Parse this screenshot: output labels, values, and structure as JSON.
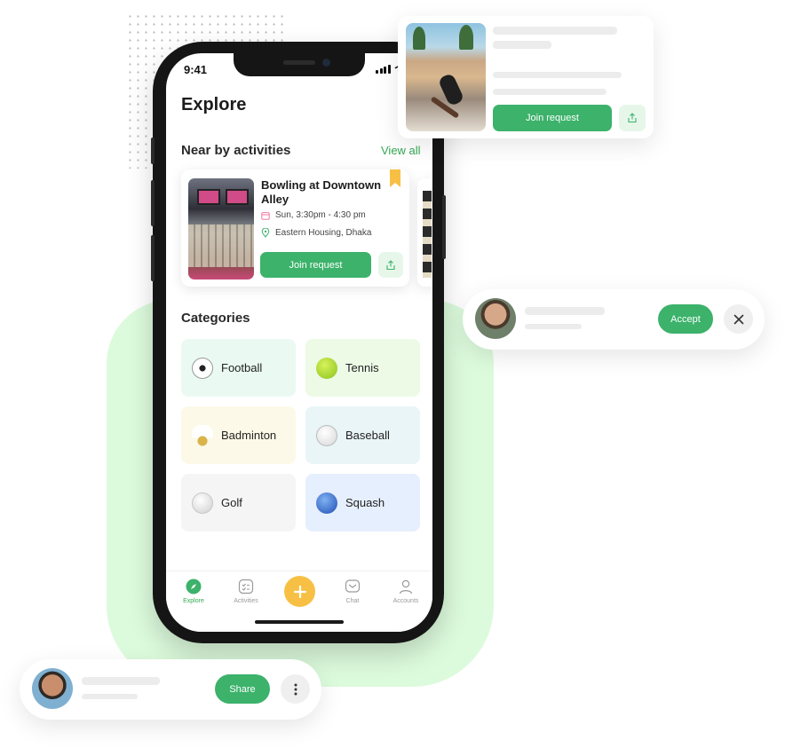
{
  "status": {
    "time": "9:41"
  },
  "explore": {
    "title": "Explore",
    "nearby": {
      "heading": "Near by activities",
      "view_all": "View all",
      "card": {
        "title": "Bowling at Downtown Alley",
        "time": "Sun, 3:30pm - 4:30 pm",
        "location": "Eastern Housing, Dhaka",
        "join_label": "Join request"
      }
    },
    "categories": {
      "heading": "Categories",
      "items": [
        {
          "label": "Football",
          "bg": "#eafaf2",
          "icon": "football-icon"
        },
        {
          "label": "Tennis",
          "bg": "#ecfae6",
          "icon": "tennis-ball-icon"
        },
        {
          "label": "Badminton",
          "bg": "#fdf9e8",
          "icon": "shuttlecock-icon"
        },
        {
          "label": "Baseball",
          "bg": "#e9f5f7",
          "icon": "baseball-icon"
        },
        {
          "label": "Golf",
          "bg": "#f5f5f5",
          "icon": "golf-ball-icon"
        },
        {
          "label": "Squash",
          "bg": "#e6effd",
          "icon": "squash-ball-icon"
        }
      ]
    }
  },
  "tabbar": {
    "tabs": [
      {
        "label": "Explore",
        "icon": "compass-icon",
        "active": true
      },
      {
        "label": "Activities",
        "icon": "checklist-icon",
        "active": false
      },
      {
        "label": "Chat",
        "icon": "chat-icon",
        "active": false
      },
      {
        "label": "Accounts",
        "icon": "user-icon",
        "active": false
      }
    ],
    "add_icon": "plus-icon"
  },
  "floating": {
    "activity": {
      "join_label": "Join request"
    },
    "friend_request": {
      "accept_label": "Accept"
    },
    "share": {
      "share_label": "Share"
    }
  },
  "colors": {
    "accent": "#3cb26b",
    "yellow": "#f7c044",
    "blob": "#dcfadc"
  }
}
